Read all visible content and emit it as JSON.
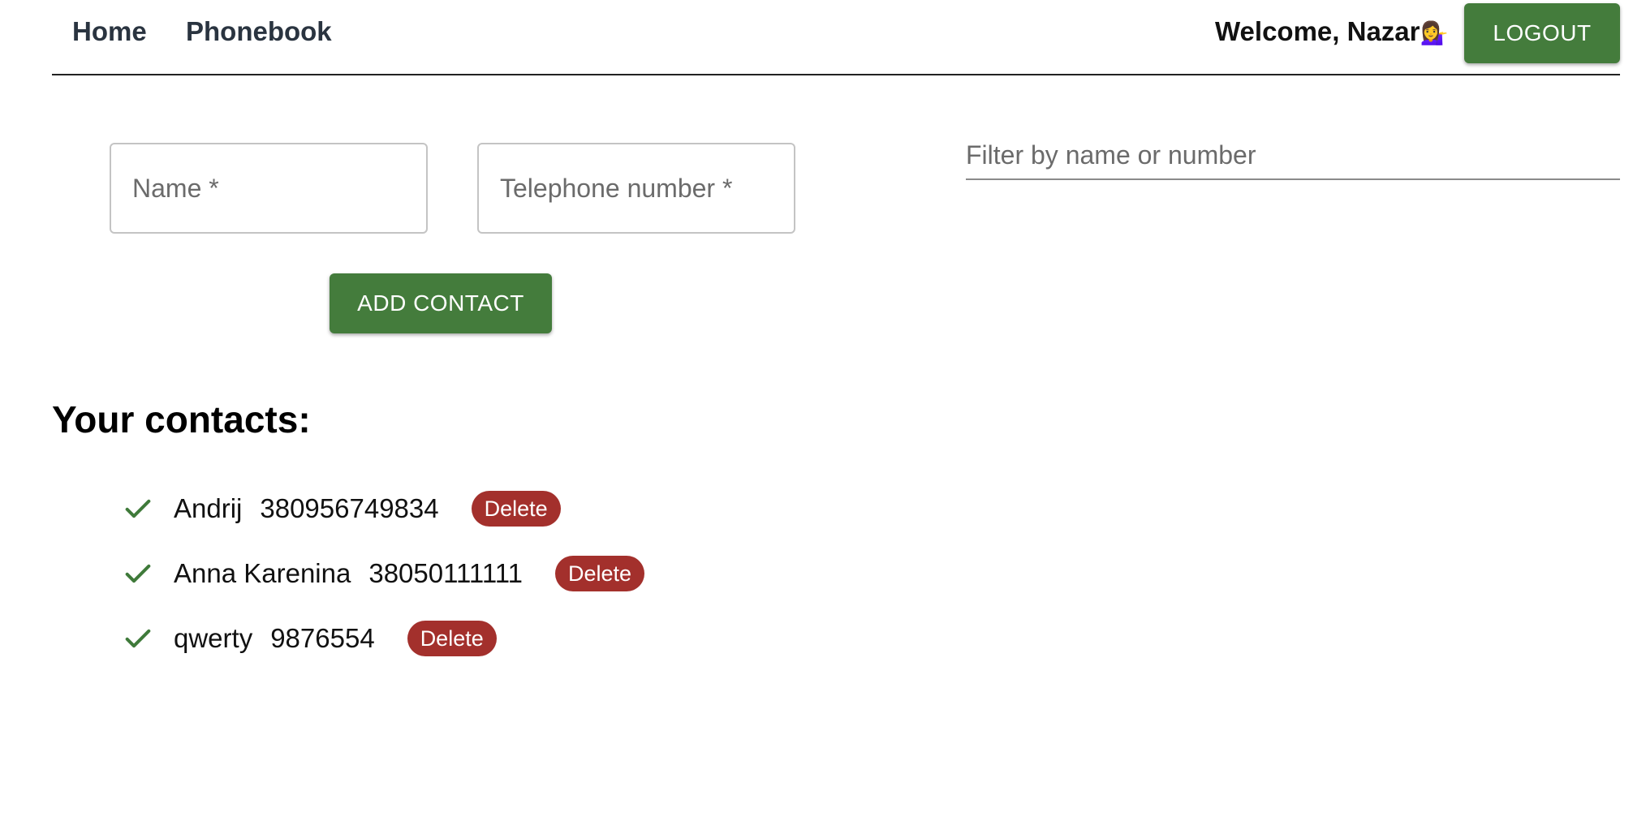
{
  "header": {
    "nav": [
      {
        "label": "Home"
      },
      {
        "label": "Phonebook"
      }
    ],
    "welcome_text": "Welcome, Nazar",
    "welcome_emoji": "💁‍♀️",
    "logout_label": "LOGOUT"
  },
  "form": {
    "name_placeholder": "Name *",
    "phone_placeholder": "Telephone number *",
    "name_value": "",
    "phone_value": "",
    "add_label": "ADD CONTACT"
  },
  "filter": {
    "placeholder": "Filter by name or number",
    "value": ""
  },
  "contacts": {
    "title": "Your contacts:",
    "items": [
      {
        "name": "Andrij",
        "number": "380956749834",
        "delete_label": "Delete"
      },
      {
        "name": "Anna Karenina",
        "number": "38050111111",
        "delete_label": "Delete"
      },
      {
        "name": "qwerty",
        "number": "9876554",
        "delete_label": "Delete"
      }
    ]
  },
  "icons": {
    "check": "check-icon"
  },
  "colors": {
    "primary_green": "#447c3c",
    "delete_red": "#a3302c",
    "check_green": "#3f7a3a"
  }
}
